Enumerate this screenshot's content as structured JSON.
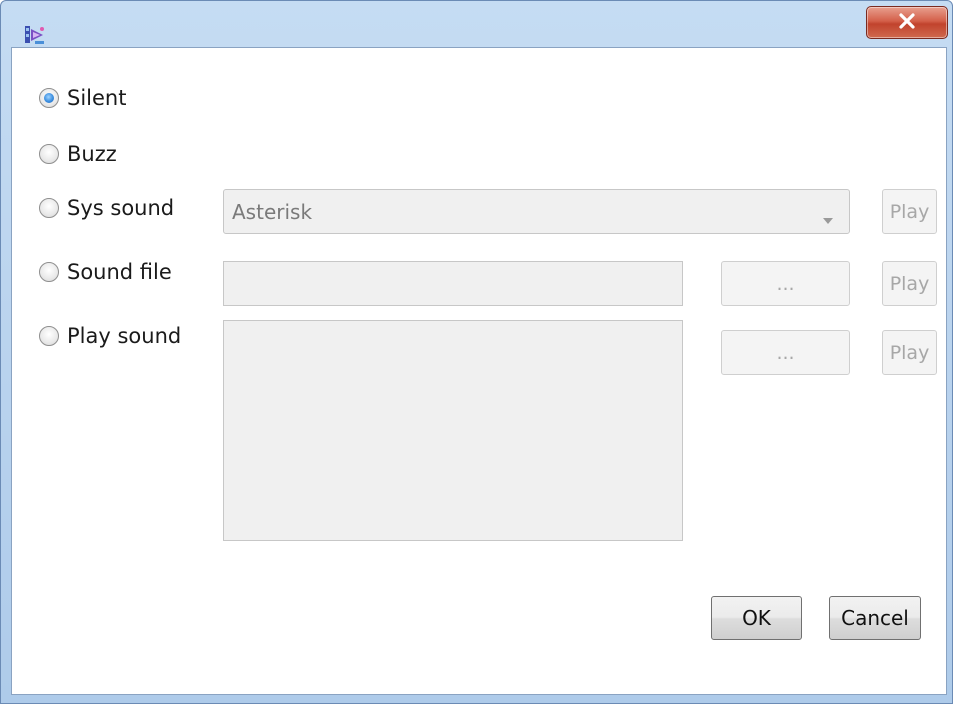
{
  "window": {
    "icons": {
      "app": "app-icon",
      "close": "close-icon"
    }
  },
  "options": [
    {
      "label": "Silent",
      "checked": true
    },
    {
      "label": "Buzz",
      "checked": false
    },
    {
      "label": "Sys sound",
      "checked": false
    },
    {
      "label": "Sound file",
      "checked": false
    },
    {
      "label": "Play sound",
      "checked": false
    }
  ],
  "sys_sound": {
    "selected": "Asterisk",
    "play_label": "Play"
  },
  "sound_file": {
    "value": "",
    "browse_label": "...",
    "play_label": "Play"
  },
  "play_sound": {
    "value": "",
    "browse_label": "...",
    "play_label": "Play"
  },
  "buttons": {
    "ok": "OK",
    "cancel": "Cancel"
  },
  "colors": {
    "accent": "#3c8fe0",
    "close_red": "#c1432d",
    "disabled_text": "#a7a7a7"
  }
}
